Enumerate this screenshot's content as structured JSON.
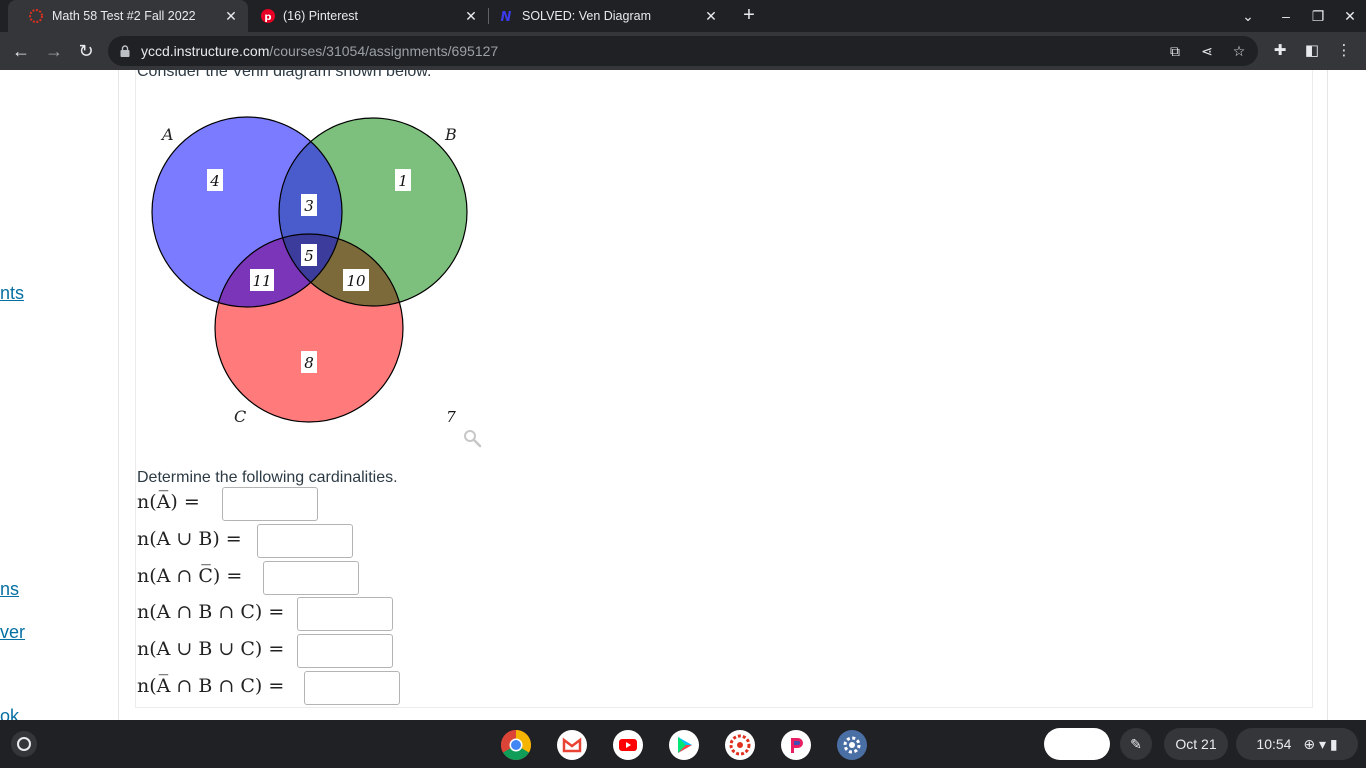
{
  "browser": {
    "tabs": [
      {
        "title": "Math 58 Test #2 Fall 2022",
        "icon": "canvas-icon",
        "active": true
      },
      {
        "title": "(16) Pinterest",
        "icon": "pinterest-icon",
        "active": false
      },
      {
        "title": "SOLVED: Ven Diagram",
        "icon": "numerade-icon",
        "active": false
      }
    ],
    "url_host": "yccd.instructure.com",
    "url_path": "/courses/31054/assignments/695127"
  },
  "sidebar_links": [
    "nts",
    "ns",
    "ver",
    "ok"
  ],
  "question": {
    "intro": "Consider the Venn diagram shown below.",
    "venn": {
      "set_labels": {
        "A": "A",
        "B": "B",
        "C": "C"
      },
      "regions": {
        "only_a": "4",
        "only_b": "1",
        "a_and_b_only": "3",
        "a_b_c": "5",
        "a_and_c_only": "11",
        "b_and_c_only": "10",
        "only_c": "8",
        "outside": "7"
      },
      "colors": {
        "A": "#7b7bff",
        "B": "#7dbf7d",
        "C": "#ff7b7b",
        "AB": "#4a5ccc",
        "AC": "#7a35b8",
        "BC": "#7d6a3a",
        "ABC": "#3c3c9c"
      }
    },
    "prompt": "Determine the following cardinalities.",
    "cardinalities": [
      {
        "label": "n(A̅) =",
        "value": ""
      },
      {
        "label": "n(A ∪ B) =",
        "value": ""
      },
      {
        "label": "n(A ∩ C̅) =",
        "value": ""
      },
      {
        "label": "n(A ∩ B ∩ C) =",
        "value": ""
      },
      {
        "label": "n(A ∪ B ∪ C) =",
        "value": ""
      },
      {
        "label": "n(A̅ ∩ B ∩ C) =",
        "value": ""
      }
    ]
  },
  "shelf": {
    "date": "Oct 21",
    "time": "10:54",
    "apps": [
      "chrome-icon",
      "gmail-icon",
      "youtube-icon",
      "play-store-icon",
      "canvas-student-icon",
      "pocket-icon",
      "settings-icon"
    ]
  }
}
